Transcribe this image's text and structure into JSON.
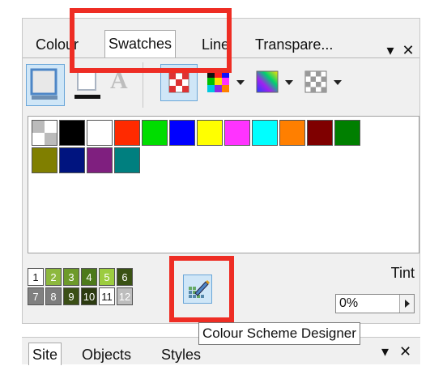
{
  "tabs": {
    "colour": "Colour",
    "swatches": "Swatches",
    "line": "Line",
    "transparency": "Transpare..."
  },
  "window_controls": {
    "menu": "▾",
    "close": "✕"
  },
  "toolbar": {
    "text_tool_glyph": "A"
  },
  "swatches": [
    {
      "name": "none",
      "color": "#ffffff"
    },
    {
      "name": "black",
      "color": "#000000"
    },
    {
      "name": "white",
      "color": "#ffffff"
    },
    {
      "name": "red",
      "color": "#ff2a00"
    },
    {
      "name": "green",
      "color": "#00dd00"
    },
    {
      "name": "blue",
      "color": "#0000ff"
    },
    {
      "name": "yellow",
      "color": "#ffff00"
    },
    {
      "name": "magenta",
      "color": "#ff33ff"
    },
    {
      "name": "cyan",
      "color": "#00ffff"
    },
    {
      "name": "orange",
      "color": "#ff7f00"
    },
    {
      "name": "maroon",
      "color": "#7f0000"
    },
    {
      "name": "dark-green",
      "color": "#007f00"
    },
    {
      "name": "olive",
      "color": "#807f00"
    },
    {
      "name": "navy",
      "color": "#00147f"
    },
    {
      "name": "purple",
      "color": "#7f1f7f"
    },
    {
      "name": "teal",
      "color": "#007f7f"
    }
  ],
  "scheme_numbers": [
    "1",
    "2",
    "3",
    "4",
    "5",
    "6",
    "7",
    "8",
    "9",
    "10",
    "11",
    "12"
  ],
  "tint": {
    "label": "Tint",
    "value": "0%"
  },
  "tooltip": "Colour Scheme Designer",
  "lower_tabs": {
    "site": "Site",
    "objects": "Objects",
    "styles": "Styles"
  }
}
